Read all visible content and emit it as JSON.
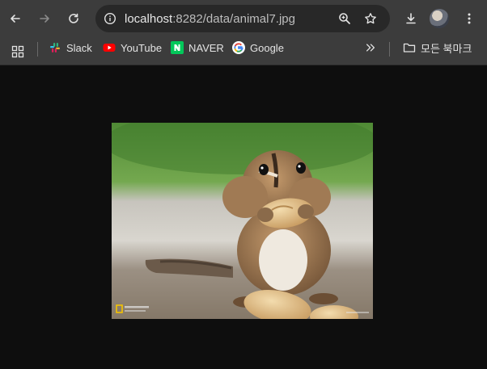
{
  "browser": {
    "url_host": "localhost",
    "url_rest": ":8282/data/animal7.jpg",
    "icons": {
      "back": "arrow-left-icon",
      "forward": "arrow-right-icon",
      "reload": "reload-icon",
      "site_info": "info-icon",
      "zoom": "zoom-icon",
      "bookmark_star": "star-icon",
      "download": "download-icon",
      "menu": "kebab-menu-icon"
    }
  },
  "bookmarks_bar": {
    "items": [
      {
        "label": "Slack",
        "icon": "slack-icon"
      },
      {
        "label": "YouTube",
        "icon": "youtube-icon"
      },
      {
        "label": "NAVER",
        "icon": "naver-icon"
      },
      {
        "label": "Google",
        "icon": "google-icon"
      }
    ],
    "overflow_icon": "chevron-double-right-icon",
    "folder_label": "모든 북마크",
    "apps_icon": "apps-grid-icon"
  },
  "image": {
    "alt": "animal7.jpg",
    "watermark": "NATIONAL GEOGRAPHIC"
  },
  "colors": {
    "toolbar": "#3c3c3c",
    "omnibox": "#282828",
    "page_bg": "#0e0e0e",
    "youtube_red": "#ff0000",
    "naver_green": "#03c75a"
  }
}
